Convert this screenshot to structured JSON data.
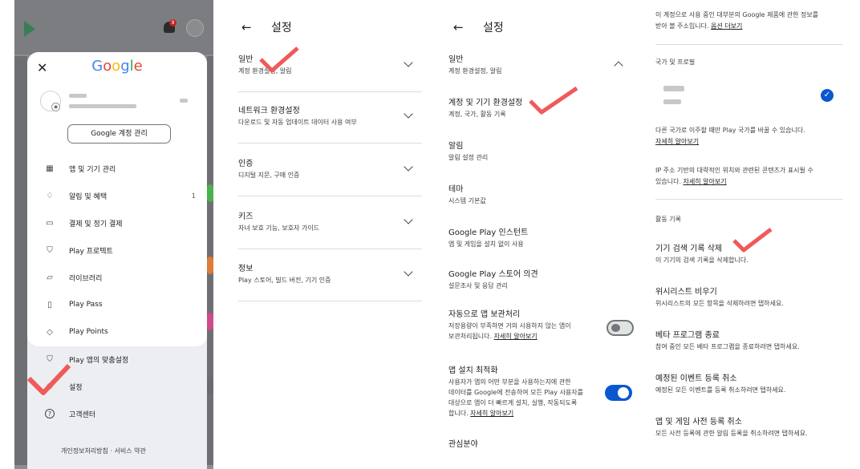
{
  "panel1": {
    "brand": "Google",
    "notification_count": "9",
    "manage_account_label": "Google 계정 관리",
    "menu": [
      {
        "label": "앱 및 기기 관리",
        "icon": "grid-icon",
        "count": ""
      },
      {
        "label": "알림 및 혜택",
        "icon": "bell-icon",
        "count": "1"
      },
      {
        "label": "결제 및 정기 결제",
        "icon": "card-icon",
        "count": ""
      },
      {
        "label": "Play 프로텍트",
        "icon": "shield-icon",
        "count": ""
      },
      {
        "label": "라이브러리",
        "icon": "folder-icon",
        "count": ""
      },
      {
        "label": "Play Pass",
        "icon": "ticket-icon",
        "count": ""
      },
      {
        "label": "Play Points",
        "icon": "diamond-icon",
        "count": ""
      },
      {
        "label": "Play 앱의 맞춤설정",
        "icon": "personalize-icon",
        "count": ""
      },
      {
        "label": "설정",
        "icon": "gear-icon",
        "count": ""
      },
      {
        "label": "고객센터",
        "icon": "help-icon",
        "count": ""
      }
    ],
    "footer": "개인정보처리방침  ·  서비스 약관"
  },
  "panel2": {
    "back_icon": "←",
    "title": "설정",
    "items": [
      {
        "title": "일반",
        "subtitle": "계정 환경설정, 알림"
      },
      {
        "title": "네트워크 환경설정",
        "subtitle": "다운로드 및 자동 업데이트 데이터 사용 여부"
      },
      {
        "title": "인증",
        "subtitle": "디지털 지문, 구매 인증"
      },
      {
        "title": "키즈",
        "subtitle": "자녀 보호 기능, 보호자 가이드"
      },
      {
        "title": "정보",
        "subtitle": "Play 스토어, 빌드 버전, 기기 인증"
      }
    ]
  },
  "panel3": {
    "back_icon": "←",
    "title": "설정",
    "general": {
      "title": "일반",
      "subtitle": "계정 환경설정, 알림"
    },
    "items": [
      {
        "title": "계정 및 기기 환경설정",
        "subtitle": "계정, 국가, 활동 기록"
      },
      {
        "title": "알림",
        "subtitle": "알림 설정 관리"
      },
      {
        "title": "테마",
        "subtitle": "시스템 기본값"
      },
      {
        "title": "Google Play 인스턴트",
        "subtitle": "앱 및 게임을 설치 없이 사용"
      },
      {
        "title": "Google Play 스토어 의견",
        "subtitle": "설문조사 및 응답 관리"
      }
    ],
    "auto_archive": {
      "title": "자동으로 앱 보관처리",
      "desc1": "저장용량이 부족하면 거의 사용하지 않는 앱이",
      "desc2": "보관처리됩니다. ",
      "link": "자세히 알아보기",
      "enabled": false
    },
    "install_opt": {
      "title": "앱 설치 최적화",
      "desc1": "사용자가 앱의 어떤 부분을 사용하는지에 관한",
      "desc2": "데이터를 Google에 전송하여 모든 Play 사용자를",
      "desc3": "대상으로 앱이 더 빠르게 설치, 실행, 작동되도록",
      "desc4": "합니다. ",
      "link": "자세히 알아보기",
      "enabled": true
    },
    "interests": "관심분야"
  },
  "panel4": {
    "top_text1": "이 계정으로 사용 중인 대부분의 Google 제품에 관한 정보를",
    "top_text2": "받아 볼 주소입니다. ",
    "top_link": "옵션 더보기",
    "country_header": "국가 및 프로필",
    "country_note": "다른 국가로 이주할 때만 Play 국가를 바꿀 수 있습니다.",
    "country_link": "자세히 알아보기",
    "ip_text1": "IP 주소 기반의 대략적인 위치와 관련된 콘텐츠가 표시될 수",
    "ip_text2": "있습니다. ",
    "ip_link": "자세히 알아보기",
    "activity_header": "활동 기록",
    "items": [
      {
        "title": "기기 검색 기록 삭제",
        "subtitle": "이 기기의 검색 기록을 삭제합니다."
      },
      {
        "title": "위시리스트 비우기",
        "subtitle": "위시리스트의 모든 항목을 삭제하려면 탭하세요."
      },
      {
        "title": "베타 프로그램 종료",
        "subtitle": "참여 중인 모든 베타 프로그램을 종료하려면 탭하세요."
      },
      {
        "title": "예정된 이벤트 등록 취소",
        "subtitle": "예정된 모든 이벤트를 등록 취소하려면 탭하세요."
      },
      {
        "title": "앱 및 게임 사전 등록 취소",
        "subtitle": "모든 사전 등록에 관한 알림 등록을 취소하려면 탭하세요."
      }
    ]
  },
  "colors": {
    "annotation": "#f05a5a",
    "accent": "#0b57d0"
  }
}
